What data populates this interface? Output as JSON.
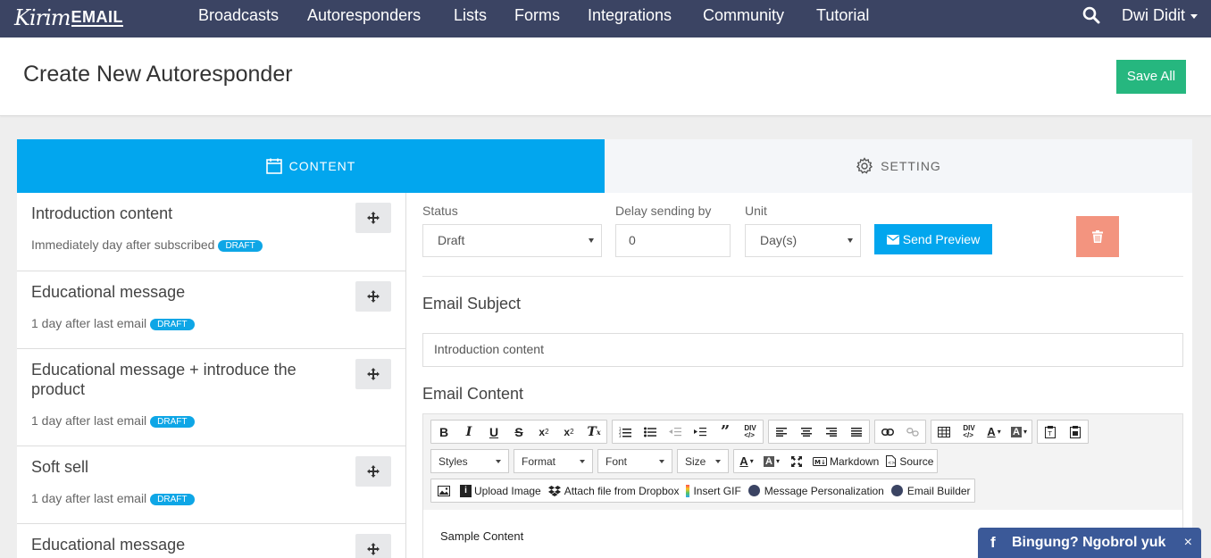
{
  "app": {
    "logo_script": "Kirim",
    "logo_email": "EMAIL"
  },
  "nav": {
    "items": [
      "Broadcasts",
      "Autoresponders",
      "Lists",
      "Forms",
      "Integrations",
      "Community",
      "Tutorial"
    ],
    "user": "Dwi Didit"
  },
  "header": {
    "title": "Create New Autoresponder",
    "save_label": "Save All"
  },
  "tabs": {
    "content": "CONTENT",
    "setting": "SETTING",
    "active": "content"
  },
  "autoresponders": [
    {
      "title": "Introduction content",
      "timing": "Immediately day after subscribed",
      "status": "DRAFT"
    },
    {
      "title": "Educational message",
      "timing": "1 day after last email",
      "status": "DRAFT"
    },
    {
      "title": "Educational message + introduce the product",
      "timing": "1 day after last email",
      "status": "DRAFT"
    },
    {
      "title": "Soft sell",
      "timing": "1 day after last email",
      "status": "DRAFT"
    },
    {
      "title": "Educational message",
      "timing": "",
      "status": ""
    }
  ],
  "form": {
    "status_label": "Status",
    "status_value": "Draft",
    "delay_label": "Delay sending by",
    "delay_value": "0",
    "unit_label": "Unit",
    "unit_value": "Day(s)",
    "send_preview_label": "Send Preview",
    "subject_heading": "Email Subject",
    "subject_value": "Introduction content",
    "content_heading": "Email Content",
    "sample_content": "Sample Content"
  },
  "editor": {
    "dropdowns": [
      "Styles",
      "Format",
      "Font",
      "Size"
    ],
    "markdown_label": "Markdown",
    "source_label": "Source",
    "upload_image_label": "Upload Image",
    "dropbox_label": "Attach file from Dropbox",
    "gif_label": "Insert GIF",
    "personalization_label": "Message Personalization",
    "builder_label": "Email Builder"
  },
  "chat": {
    "text": "Bingung? Ngobrol yuk",
    "close": "×"
  },
  "colors": {
    "nav_bg": "#3b4463",
    "accent": "#02a6ee",
    "save_green": "#26b77f",
    "delete_salmon": "#f3947f",
    "chat_bg": "#3b5998"
  }
}
